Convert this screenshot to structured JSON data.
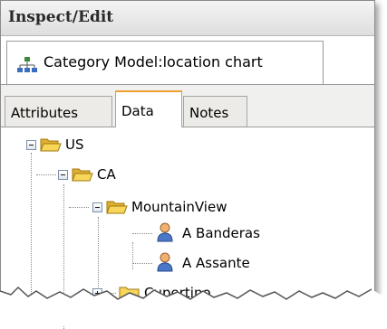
{
  "window": {
    "title": "Inspect/Edit"
  },
  "model_tab": {
    "label": "Category Model:location chart",
    "icon": "category-model-icon"
  },
  "tabs": [
    {
      "label": "Attributes",
      "active": false
    },
    {
      "label": "Data",
      "active": true
    },
    {
      "label": "Notes",
      "active": false
    }
  ],
  "tree": {
    "nodes": [
      {
        "label": "US",
        "type": "folder",
        "expanded": true
      },
      {
        "label": "CA",
        "type": "folder",
        "expanded": true
      },
      {
        "label": "MountainView",
        "type": "folder",
        "expanded": true
      },
      {
        "label": "A Banderas",
        "type": "person"
      },
      {
        "label": "A Assante",
        "type": "person"
      },
      {
        "label": "Cupertino",
        "type": "folder",
        "expanded": false
      }
    ]
  },
  "colors": {
    "active_tab_accent": "#f0a030",
    "folder_yellow": "#f5cf4a"
  }
}
